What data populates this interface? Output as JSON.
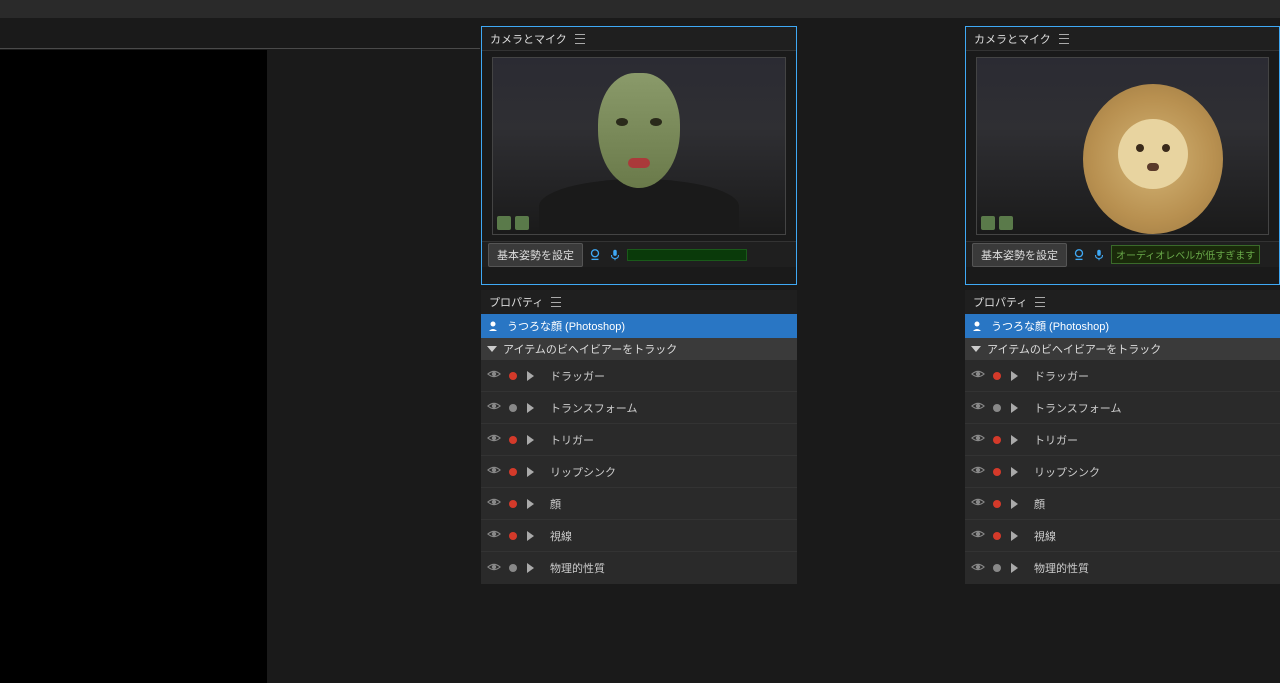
{
  "panelA": {
    "title": "カメラとマイク",
    "poseButton": "基本姿勢を設定",
    "audioStatus": ""
  },
  "panelB": {
    "title": "カメラとマイク",
    "poseButton": "基本姿勢を設定",
    "audioStatus": "オーディオレベルが低すぎます"
  },
  "properties": {
    "title": "プロパティ",
    "selectedItem": "うつろな顔 (Photoshop)",
    "trackerHeader": "アイテムのビヘイビアーをトラック",
    "behaviors": [
      {
        "label": "ドラッガー",
        "rec": true
      },
      {
        "label": "トランスフォーム",
        "rec": false
      },
      {
        "label": "トリガー",
        "rec": true
      },
      {
        "label": "リップシンク",
        "rec": true
      },
      {
        "label": "顔",
        "rec": true
      },
      {
        "label": "視線",
        "rec": true
      },
      {
        "label": "物理的性質",
        "rec": false
      }
    ]
  }
}
